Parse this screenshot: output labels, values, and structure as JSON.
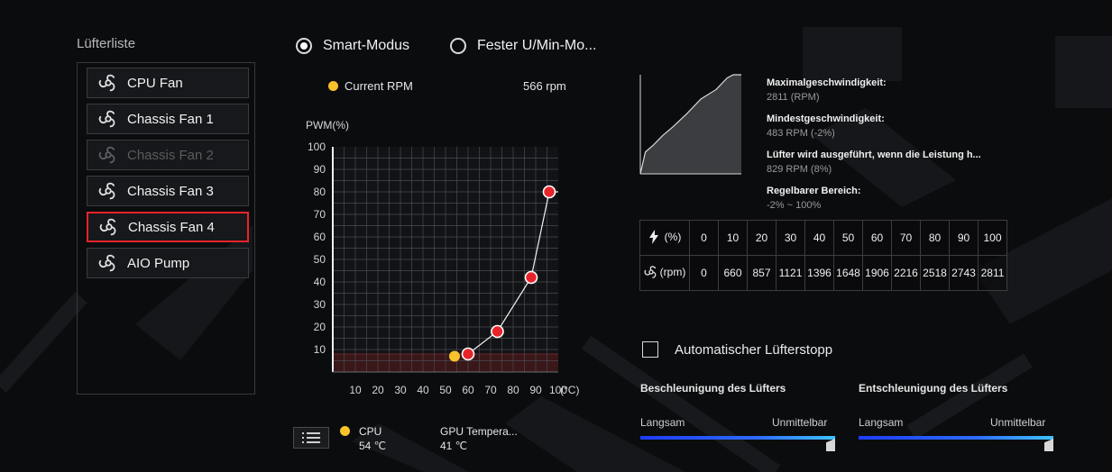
{
  "fan_list": {
    "title": "Lüfterliste",
    "items": [
      {
        "label": "CPU Fan",
        "state": "normal"
      },
      {
        "label": "Chassis Fan 1",
        "state": "normal"
      },
      {
        "label": "Chassis Fan 2",
        "state": "disabled"
      },
      {
        "label": "Chassis Fan 3",
        "state": "normal"
      },
      {
        "label": "Chassis Fan 4",
        "state": "selected"
      },
      {
        "label": "AIO Pump",
        "state": "normal"
      }
    ]
  },
  "modes": {
    "smart": "Smart-Modus",
    "fixed": "Fester U/Min-Mo...",
    "selected": "smart"
  },
  "current_rpm": {
    "label": "Current RPM",
    "value": "566 rpm"
  },
  "chart_data": {
    "type": "line",
    "ylabel": "PWM(%)",
    "xlabel": "(°C)",
    "x_ticks": [
      10,
      20,
      30,
      40,
      50,
      60,
      70,
      80,
      90,
      100
    ],
    "y_ticks": [
      10,
      20,
      30,
      40,
      50,
      60,
      70,
      80,
      90,
      100
    ],
    "xlim": [
      0,
      100
    ],
    "ylim": [
      0,
      100
    ],
    "curve_points": [
      {
        "x": 60,
        "y": 8
      },
      {
        "x": 73,
        "y": 18
      },
      {
        "x": 88,
        "y": 42
      },
      {
        "x": 96,
        "y": 80
      }
    ],
    "current_point": {
      "x": 54,
      "y": 7
    },
    "min_band_y": 8,
    "colors": {
      "point": "#e8242b",
      "current": "#f7c22b",
      "band": "#3a1719"
    }
  },
  "sources": {
    "cpu": {
      "label": "CPU",
      "value": "54 ℃"
    },
    "gpu": {
      "label": "GPU Tempera...",
      "value": "41 ℃"
    }
  },
  "info": {
    "max_label": "Maximalgeschwindigkeit:",
    "max_value": "2811 (RPM)",
    "min_label": "Mindestgeschwindigkeit:",
    "min_value": "483 RPM (-2%)",
    "run_label": "Lüfter wird ausgeführt, wenn die Leistung h...",
    "run_value": "829 RPM (8%)",
    "range_label": "Regelbarer Bereich:",
    "range_value": "-2% ~ 100%"
  },
  "mini_chart": {
    "points": [
      [
        0,
        0
      ],
      [
        5,
        28
      ],
      [
        13,
        37
      ],
      [
        22,
        49
      ],
      [
        32,
        60
      ],
      [
        46,
        77
      ],
      [
        60,
        96
      ],
      [
        75,
        108
      ],
      [
        86,
        123
      ],
      [
        92,
        127
      ],
      [
        100,
        127
      ]
    ],
    "x_range": [
      0,
      100
    ],
    "y_range": [
      0,
      127
    ]
  },
  "rpm_table": {
    "pct_header": "(%)",
    "rpm_header": "(rpm)",
    "pct": [
      "0",
      "10",
      "20",
      "30",
      "40",
      "50",
      "60",
      "70",
      "80",
      "90",
      "100"
    ],
    "rpm": [
      "0",
      "660",
      "857",
      "1121",
      "1396",
      "1648",
      "1906",
      "2216",
      "2518",
      "2743",
      "2811"
    ]
  },
  "auto_stop": {
    "label": "Automatischer Lüfterstopp",
    "checked": false
  },
  "acceleration": {
    "title": "Beschleunigung des Lüfters",
    "slow": "Langsam",
    "fast": "Unmittelbar",
    "value": 1.0
  },
  "deceleration": {
    "title": "Entschleunigung des Lüfters",
    "slow": "Langsam",
    "fast": "Unmittelbar",
    "value": 1.0
  }
}
